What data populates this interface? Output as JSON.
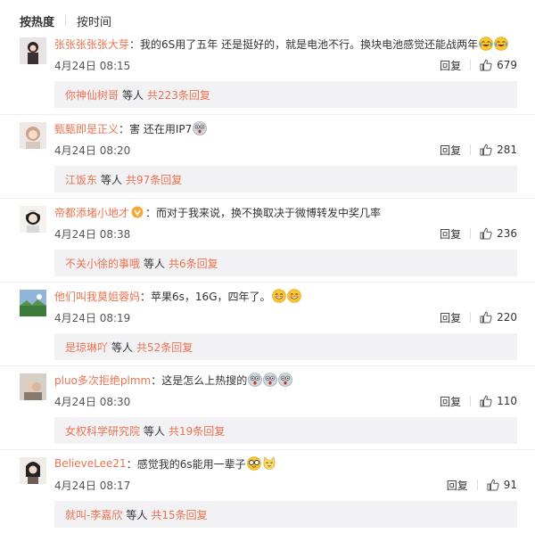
{
  "sort": {
    "hot": "按热度",
    "time": "按时间"
  },
  "comments": [
    {
      "user": "张张张张张大芽",
      "text": "我的6S用了五年 还是挺好的，就是电池不行。换块电池感觉还能战两年",
      "emojis": [
        "laugh-cry-emoji",
        "laugh-cry-emoji"
      ],
      "time": "4月24日 08:15",
      "reply": "回复",
      "likes": "679",
      "replyUser": "你神仙树哥",
      "replyMid": "等人",
      "replyCount": "共223条回复"
    },
    {
      "user": "甄甄即是正义",
      "text": "害 还在用IP7",
      "emojis": [
        "shocked-emoji"
      ],
      "time": "4月24日 08:20",
      "reply": "回复",
      "likes": "281",
      "replyUser": "江饭东",
      "replyMid": "等人",
      "replyCount": "共97条回复"
    },
    {
      "user": "帝都添堵小地才",
      "text": "而对于我来说，换不换取决于微博转发中奖几率",
      "emojis": [],
      "time": "4月24日 08:38",
      "reply": "回复",
      "likes": "236",
      "replyUser": "不关小徐的事哦",
      "replyMid": "等人",
      "replyCount": "共6条回复"
    },
    {
      "user": "他们叫我莫姐蓉妈",
      "text": "苹果6s，16G，四年了。",
      "emojis": [
        "grin-emoji",
        "grin-emoji"
      ],
      "time": "4月24日 08:19",
      "reply": "回复",
      "likes": "220",
      "replyUser": "是琼琳吖",
      "replyMid": "等人",
      "replyCount": "共52条回复"
    },
    {
      "user": "pluo多次拒绝plmm",
      "text": "这是怎么上热搜的",
      "emojis": [
        "shocked-emoji",
        "shocked-emoji",
        "shocked-emoji"
      ],
      "time": "4月24日 08:30",
      "reply": "回复",
      "likes": "110",
      "replyUser": "女权科学研究院",
      "replyMid": "等人",
      "replyCount": "共19条回复"
    },
    {
      "user": "BelieveLee21",
      "text": "感觉我的6s能用一辈子",
      "emojis": [
        "glasses-emoji",
        "cat-emoji"
      ],
      "time": "4月24日 08:17",
      "reply": "回复",
      "likes": "91",
      "replyUser": "就叫-李嘉欣",
      "replyMid": "等人",
      "replyCount": "共15条回复"
    }
  ],
  "colors": {
    "username": "#eb7350",
    "replyBox": "#f2f2f5",
    "text": "#333333"
  }
}
